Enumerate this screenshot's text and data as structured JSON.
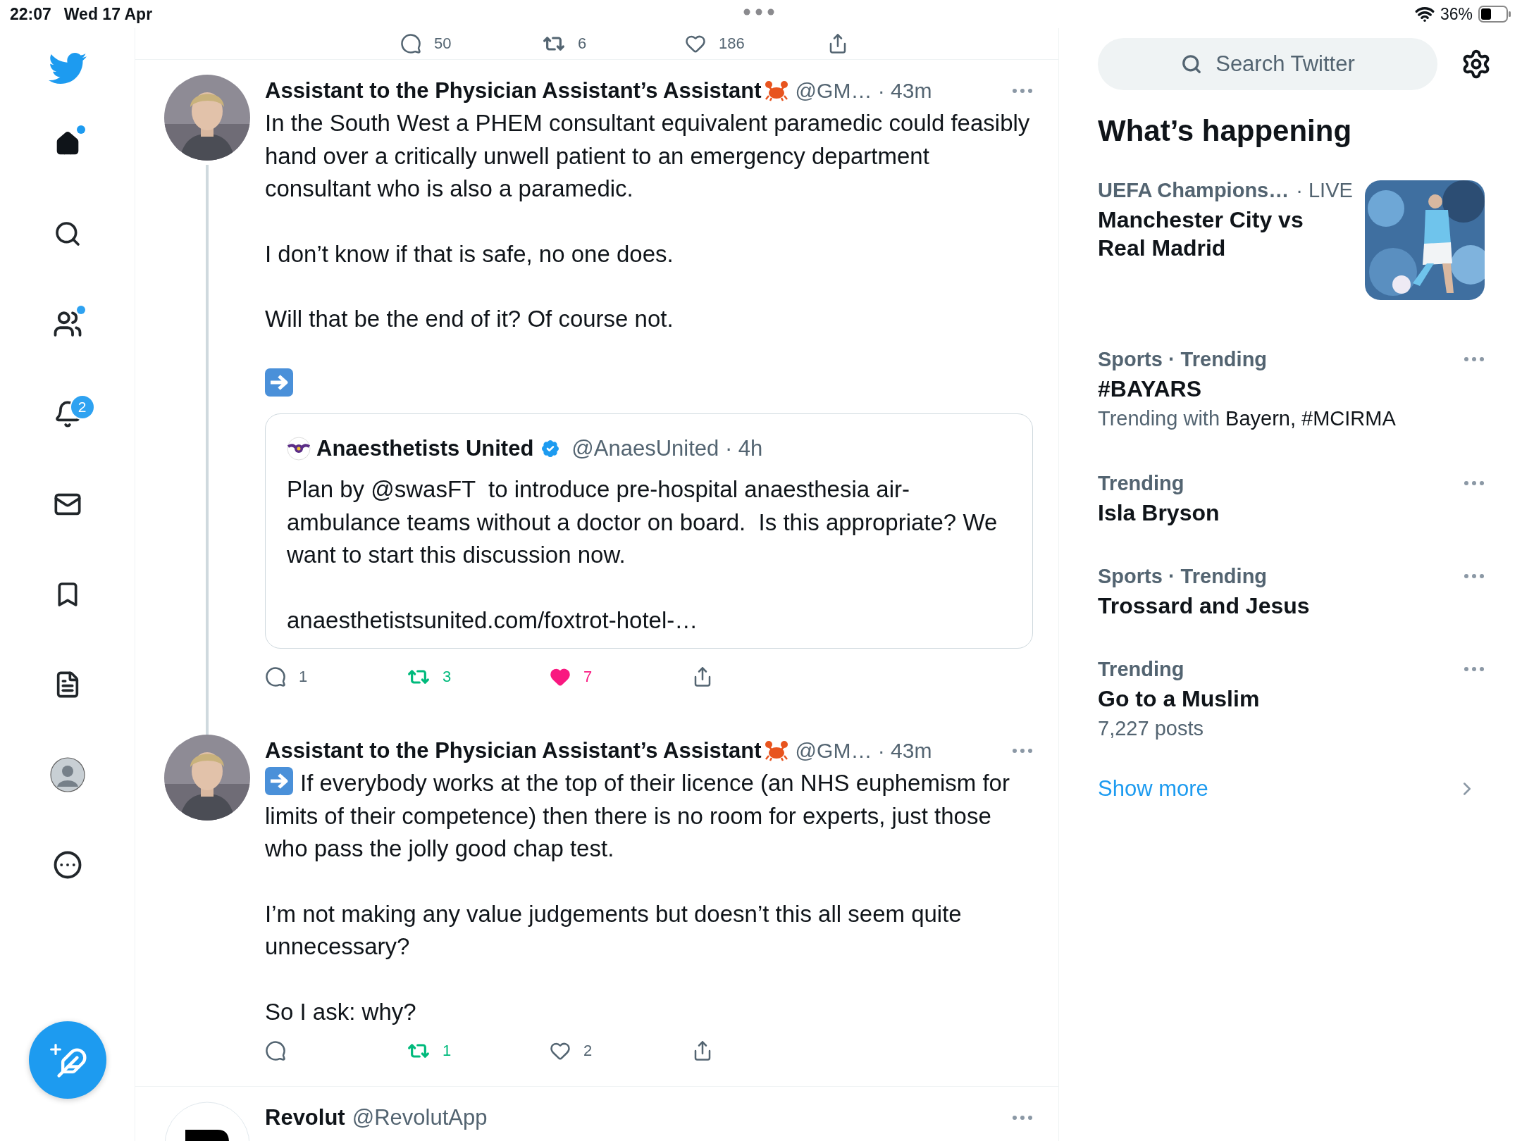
{
  "status_bar": {
    "time": "22:07",
    "date": "Wed 17 Apr",
    "battery": "36%"
  },
  "sidebar": {
    "items": [
      {
        "kind": "home",
        "selected": true,
        "dot": true
      },
      {
        "kind": "explore",
        "selected": false
      },
      {
        "kind": "communities",
        "selected": false,
        "dot": true
      },
      {
        "kind": "notifications",
        "selected": false,
        "badge": "2"
      },
      {
        "kind": "messages",
        "selected": false
      },
      {
        "kind": "bookmarks",
        "selected": false
      },
      {
        "kind": "lists",
        "selected": false
      },
      {
        "kind": "profile",
        "selected": false
      },
      {
        "kind": "more",
        "selected": false
      }
    ]
  },
  "top_actions": [
    {
      "kind": "reply",
      "count": "50",
      "active": false
    },
    {
      "kind": "retweet",
      "count": "6",
      "active": false
    },
    {
      "kind": "like",
      "count": "186",
      "active": false
    },
    {
      "kind": "share",
      "active": false
    }
  ],
  "tweets": [
    {
      "name": "Assistant to the Physician Assistant’s Assistant",
      "meta": "@GM… · 43m",
      "thread": true,
      "paragraphs": [
        {
          "text": "In the South West a PHEM consultant equivalent paramedic could feasibly hand over a critically unwell patient to an emergency department consultant who is also a paramedic.",
          "arrow": false
        },
        {
          "text": "I don’t know if that is safe, no one does.",
          "arrow": false
        },
        {
          "text": "Will that be the end of it? Of course not.",
          "arrow": false
        },
        {
          "arrow": true
        }
      ],
      "quote": {
        "name": "Anaesthetists United",
        "verified": true,
        "meta": "@AnaesUnited · 4h",
        "paragraphs": [
          "Plan by @swasFT  to introduce pre-hospital anaesthesia air-ambulance teams without a doctor on board.  Is this appropriate? We want to start this discussion now.",
          "anaesthetistsunited.com/foxtrot-hotel-…"
        ]
      },
      "actions": [
        {
          "kind": "reply",
          "count": "1",
          "active": false
        },
        {
          "kind": "retweet",
          "count": "3",
          "active": true
        },
        {
          "kind": "like",
          "count": "7",
          "active": true
        },
        {
          "kind": "share",
          "active": false
        }
      ]
    },
    {
      "name": "Assistant to the Physician Assistant’s Assistant",
      "meta": "@GM… · 43m",
      "thread": false,
      "paragraphs": [
        {
          "text": "If everybody works at the top of their licence (an NHS euphemism for limits of their competence) then there is no room for experts, just those who pass the jolly good chap test.",
          "arrow": true
        },
        {
          "text": "I’m not making any value judgements but doesn’t this all seem quite unnecessary?",
          "arrow": false
        },
        {
          "text": "So I ask: why?",
          "arrow": false
        }
      ],
      "actions": [
        {
          "kind": "reply",
          "active": false
        },
        {
          "kind": "retweet",
          "count": "1",
          "active": true
        },
        {
          "kind": "like",
          "count": "2",
          "active": false
        },
        {
          "kind": "share",
          "active": false
        }
      ]
    }
  ],
  "next_tweet": {
    "name": "Revolut",
    "handle": "@RevolutApp"
  },
  "search": {
    "placeholder": "Search Twitter"
  },
  "trends_title": "What’s happening",
  "trends": [
    {
      "kind": "event",
      "category": "UEFA Champions…",
      "context": "· LIVE",
      "title": "Manchester City vs Real Madrid"
    },
    {
      "kind": "trend",
      "category": "Sports · Trending",
      "title": "#BAYARS",
      "with_label": "Trending with",
      "with": "Bayern, #MCIRMA"
    },
    {
      "kind": "trend",
      "category": "Trending",
      "title": "Isla Bryson"
    },
    {
      "kind": "trend",
      "category": "Sports · Trending",
      "title": "Trossard and Jesus"
    },
    {
      "kind": "trend",
      "category": "Trending",
      "title": "Go to a Muslim",
      "posts": "7,227 posts"
    }
  ],
  "show_more": "Show more"
}
